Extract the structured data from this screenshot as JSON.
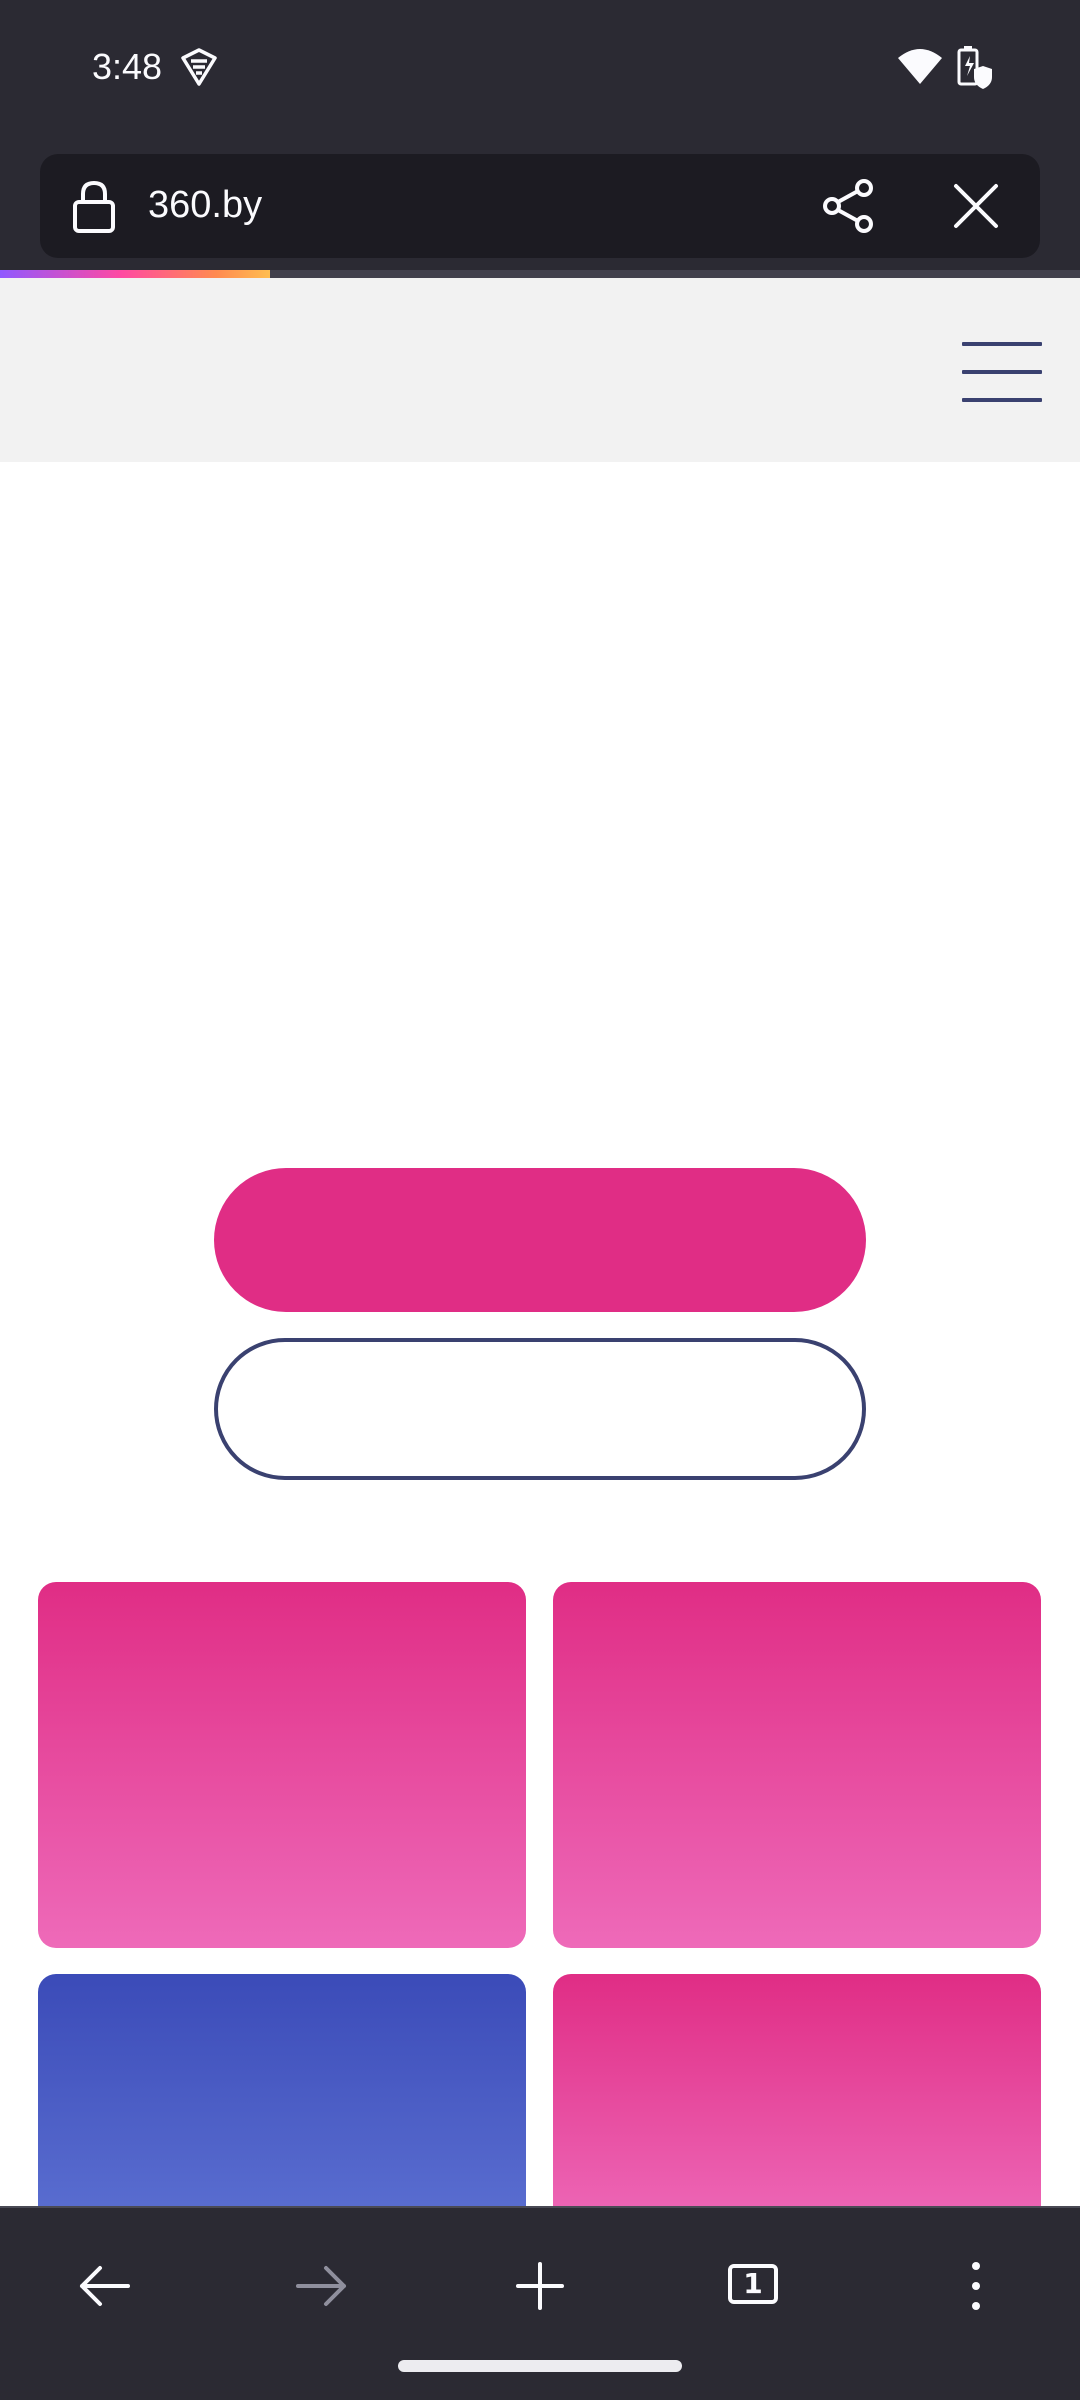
{
  "status_bar": {
    "time": "3:48",
    "icons": [
      "vpn-key-icon",
      "wifi-icon",
      "battery-charging-icon"
    ]
  },
  "toolbar": {
    "url": "360.by",
    "icons": [
      "lock-icon",
      "share-icon",
      "close-icon"
    ],
    "load_progress": 0.25
  },
  "page": {
    "header_icons": [
      "hamburger-menu-icon"
    ],
    "colors": {
      "primary": "#e02d85",
      "navy": "#3a4170",
      "blue_card": "#3b4bb8",
      "header_bg": "#f2f2f2"
    }
  },
  "bottom_nav": {
    "tab_count": "1",
    "icons": [
      "back-arrow-icon",
      "forward-arrow-icon",
      "plus-icon",
      "tabs-icon",
      "more-vertical-icon"
    ]
  }
}
